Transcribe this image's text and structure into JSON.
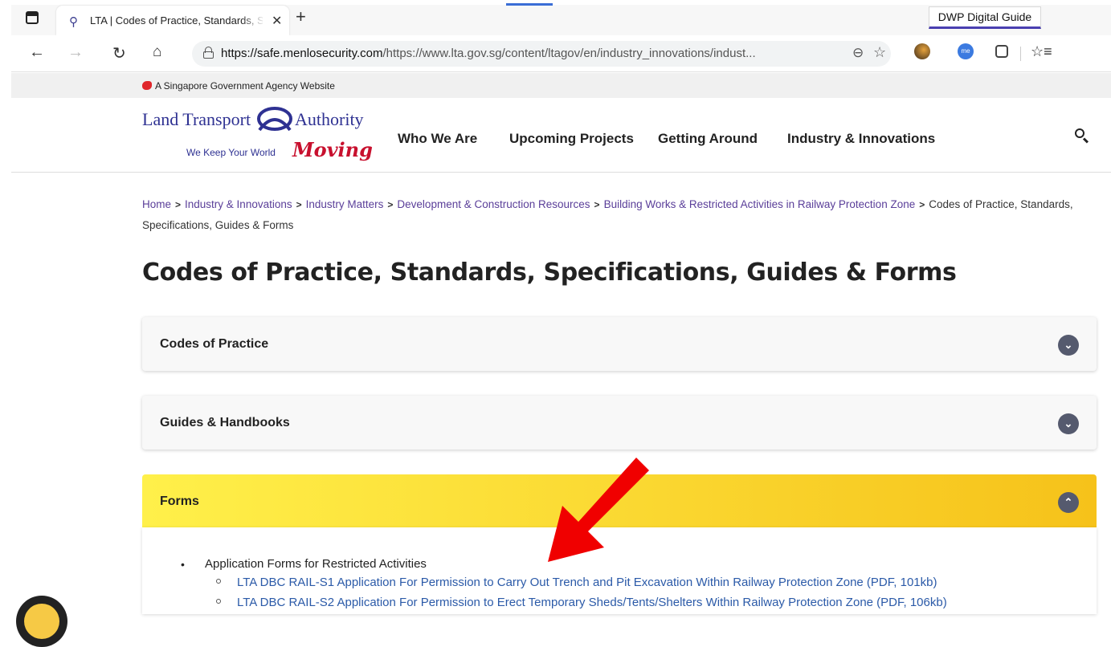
{
  "browser": {
    "tab_title": "LTA | Codes of Practice, Standards, Specifications, Guides & Forms",
    "tab_close": "✕",
    "new_tab": "+",
    "extension_badge": "DWP Digital Guide",
    "url_domain": "https://safe.menlosecurity.com",
    "url_rest": "/https://www.lta.gov.sg/content/ltagov/en/industry_innovations/indust...",
    "ext_me_label": "me",
    "icons": {
      "back": "back-arrow-icon",
      "forward": "forward-arrow-icon",
      "refresh": "refresh-icon",
      "home": "home-icon",
      "lock": "lock-icon",
      "zoom": "zoom-out-icon",
      "favorite": "add-favorite-icon",
      "favorites": "favorites-icon"
    }
  },
  "gov_banner": {
    "text": "A Singapore Government Agency Website"
  },
  "site": {
    "logo_left": "Land Transport",
    "logo_right": "Authority",
    "logo_tagline": "We Keep Your World",
    "logo_moving": "Moving",
    "nav": [
      "Who We Are",
      "Upcoming Projects",
      "Getting Around",
      "Industry & Innovations"
    ],
    "brand_color": "#2e3192"
  },
  "breadcrumb": {
    "items": [
      "Home",
      "Industry & Innovations",
      "Industry Matters",
      "Development & Construction Resources",
      "Building Works & Restricted Activities in Railway Protection Zone"
    ],
    "current": "Codes of Practice, Standards, Specifications, Guides & Forms"
  },
  "page": {
    "title": "Codes of Practice, Standards, Specifications, Guides & Forms"
  },
  "accordions": [
    {
      "label": "Codes of Practice",
      "expanded": false
    },
    {
      "label": "Guides & Handbooks",
      "expanded": false
    },
    {
      "label": "Forms",
      "expanded": true
    }
  ],
  "forms": {
    "group_label": "Application Forms for Restricted Activities",
    "links": [
      "LTA DBC RAIL-S1 Application For Permission to Carry Out Trench and Pit Excavation Within Railway Protection Zone (PDF, 101kb)",
      "LTA DBC RAIL-S2 Application For Permission to Erect Temporary Sheds/Tents/Shelters Within Railway Protection Zone (PDF, 106kb)"
    ]
  },
  "colors": {
    "accordion_open_start": "#fff04a",
    "accordion_open_end": "#f6c21a",
    "annotation_arrow": "#f00000",
    "link": "#2b5aa8"
  }
}
